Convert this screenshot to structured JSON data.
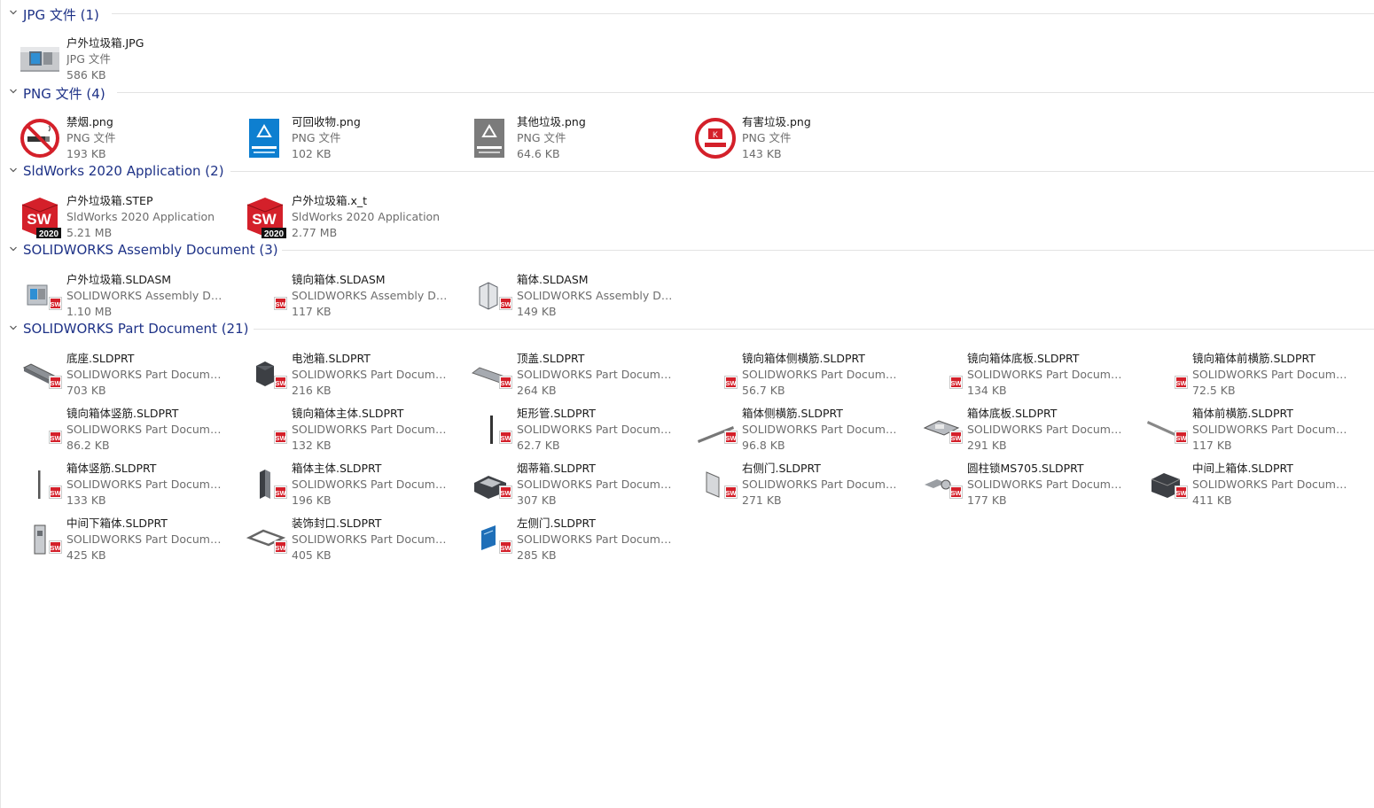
{
  "groups": [
    {
      "title": "JPG 文件 (1)",
      "items": [
        {
          "name": "户外垃圾箱.JPG",
          "type": "JPG 文件",
          "size": "586 KB",
          "icon": "photo-thumbnail-icon"
        }
      ]
    },
    {
      "title": "PNG 文件 (4)",
      "items": [
        {
          "name": "禁烟.png",
          "type": "PNG 文件",
          "size": "193 KB",
          "icon": "no-smoking-sign-icon"
        },
        {
          "name": "可回收物.png",
          "type": "PNG 文件",
          "size": "102 KB",
          "icon": "recyclable-sign-icon"
        },
        {
          "name": "其他垃圾.png",
          "type": "PNG 文件",
          "size": "64.6 KB",
          "icon": "other-waste-sign-icon"
        },
        {
          "name": "有害垃圾.png",
          "type": "PNG 文件",
          "size": "143 KB",
          "icon": "hazardous-waste-sign-icon"
        }
      ]
    },
    {
      "title": "SldWorks 2020 Application (2)",
      "items": [
        {
          "name": "户外垃圾箱.STEP",
          "type": "SldWorks 2020 Application",
          "size": "5.21 MB",
          "icon": "solidworks-2020-app-icon"
        },
        {
          "name": "户外垃圾箱.x_t",
          "type": "SldWorks 2020 Application",
          "size": "2.77 MB",
          "icon": "solidworks-2020-app-icon"
        }
      ]
    },
    {
      "title": "SOLIDWORKS Assembly Document (3)",
      "items": [
        {
          "name": "户外垃圾箱.SLDASM",
          "type": "SOLIDWORKS Assembly Docu...",
          "size": "1.10 MB",
          "icon": "assembly-bin-icon"
        },
        {
          "name": "镜向箱体.SLDASM",
          "type": "SOLIDWORKS Assembly Docu...",
          "size": "117 KB",
          "icon": "assembly-blank-icon"
        },
        {
          "name": "箱体.SLDASM",
          "type": "SOLIDWORKS Assembly Docu...",
          "size": "149 KB",
          "icon": "assembly-box-icon"
        }
      ]
    },
    {
      "title": "SOLIDWORKS Part Document (21)",
      "items": [
        {
          "name": "底座.SLDPRT",
          "type": "SOLIDWORKS Part Document",
          "size": "703 KB",
          "icon": "part-base-icon"
        },
        {
          "name": "电池箱.SLDPRT",
          "type": "SOLIDWORKS Part Document",
          "size": "216 KB",
          "icon": "part-battery-box-icon"
        },
        {
          "name": "顶盖.SLDPRT",
          "type": "SOLIDWORKS Part Document",
          "size": "264 KB",
          "icon": "part-top-cover-icon"
        },
        {
          "name": "镜向箱体侧横筋.SLDPRT",
          "type": "SOLIDWORKS Part Document",
          "size": "56.7 KB",
          "icon": "part-blank-icon"
        },
        {
          "name": "镜向箱体底板.SLDPRT",
          "type": "SOLIDWORKS Part Document",
          "size": "134 KB",
          "icon": "part-blank-icon"
        },
        {
          "name": "镜向箱体前横筋.SLDPRT",
          "type": "SOLIDWORKS Part Document",
          "size": "72.5 KB",
          "icon": "part-blank-icon"
        },
        {
          "name": "镜向箱体竖筋.SLDPRT",
          "type": "SOLIDWORKS Part Document",
          "size": "86.2 KB",
          "icon": "part-blank-icon"
        },
        {
          "name": "镜向箱体主体.SLDPRT",
          "type": "SOLIDWORKS Part Document",
          "size": "132 KB",
          "icon": "part-blank-icon"
        },
        {
          "name": "矩形管.SLDPRT",
          "type": "SOLIDWORKS Part Document",
          "size": "62.7 KB",
          "icon": "part-rect-tube-icon"
        },
        {
          "name": "箱体侧横筋.SLDPRT",
          "type": "SOLIDWORKS Part Document",
          "size": "96.8 KB",
          "icon": "part-side-rib-icon"
        },
        {
          "name": "箱体底板.SLDPRT",
          "type": "SOLIDWORKS Part Document",
          "size": "291 KB",
          "icon": "part-bottom-plate-icon"
        },
        {
          "name": "箱体前横筋.SLDPRT",
          "type": "SOLIDWORKS Part Document",
          "size": "117 KB",
          "icon": "part-front-rib-icon"
        },
        {
          "name": "箱体竖筋.SLDPRT",
          "type": "SOLIDWORKS Part Document",
          "size": "133 KB",
          "icon": "part-vertical-rib-icon"
        },
        {
          "name": "箱体主体.SLDPRT",
          "type": "SOLIDWORKS Part Document",
          "size": "196 KB",
          "icon": "part-box-body-icon"
        },
        {
          "name": "烟蒂箱.SLDPRT",
          "type": "SOLIDWORKS Part Document",
          "size": "307 KB",
          "icon": "part-ashtray-box-icon"
        },
        {
          "name": "右侧门.SLDPRT",
          "type": "SOLIDWORKS Part Document",
          "size": "271 KB",
          "icon": "part-right-door-icon"
        },
        {
          "name": "圆柱锁MS705.SLDPRT",
          "type": "SOLIDWORKS Part Document",
          "size": "177 KB",
          "icon": "part-cylinder-lock-icon"
        },
        {
          "name": "中间上箱体.SLDPRT",
          "type": "SOLIDWORKS Part Document",
          "size": "411 KB",
          "icon": "part-upper-box-icon"
        },
        {
          "name": "中间下箱体.SLDPRT",
          "type": "SOLIDWORKS Part Document",
          "size": "425 KB",
          "icon": "part-lower-box-icon"
        },
        {
          "name": "装饰封口.SLDPRT",
          "type": "SOLIDWORKS Part Document",
          "size": "405 KB",
          "icon": "part-decor-seal-icon"
        },
        {
          "name": "左侧门.SLDPRT",
          "type": "SOLIDWORKS Part Document",
          "size": "285 KB",
          "icon": "part-left-door-icon"
        }
      ]
    }
  ],
  "colors": {
    "group_title": "#1e3287",
    "sw_red": "#d4202a",
    "recycle_blue": "#0e7fd0",
    "other_gray": "#7b7b7b"
  }
}
